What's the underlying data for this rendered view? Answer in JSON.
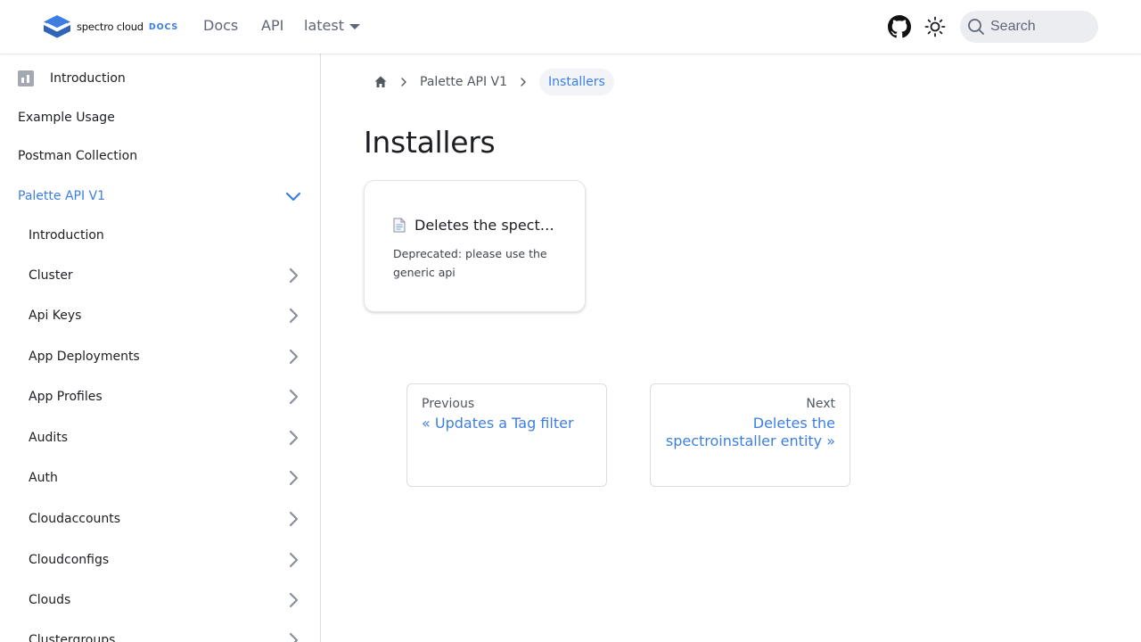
{
  "navbar": {
    "logo_text": "spectro cloud",
    "logo_badge": "DOCS",
    "links": {
      "docs": "Docs",
      "api": "API",
      "version": "latest"
    },
    "search_placeholder": "Search",
    "icons": {
      "github": "github-icon",
      "theme": "sun-icon",
      "search": "search-icon"
    }
  },
  "sidebar": {
    "items": [
      {
        "label": "Introduction"
      },
      {
        "label": "Example Usage"
      },
      {
        "label": "Postman Collection"
      },
      {
        "label": "Palette API V1"
      },
      {
        "label": "Introduction"
      },
      {
        "label": "Cluster"
      },
      {
        "label": "Api Keys"
      },
      {
        "label": "App Deployments"
      },
      {
        "label": "App Profiles"
      },
      {
        "label": "Audits"
      },
      {
        "label": "Auth"
      },
      {
        "label": "Cloudaccounts"
      },
      {
        "label": "Cloudconfigs"
      },
      {
        "label": "Clouds"
      },
      {
        "label": "Clustergroups"
      }
    ]
  },
  "breadcrumb": {
    "parent": "Palette API V1",
    "current": "Installers"
  },
  "main": {
    "title": "Installers",
    "card": {
      "title": "Deletes the spectroinstaller entity",
      "description": "Deprecated: please use the generic api"
    },
    "pager": {
      "prev_sub": "Previous",
      "prev_label": "« Updates a Tag filter",
      "next_sub": "Next",
      "next_label": "Deletes the spectroinstaller entity »"
    }
  },
  "colors": {
    "accent": "#3c7fe0",
    "text": "#1c1e21",
    "muted": "#5f6677",
    "border": "#dadde1"
  }
}
